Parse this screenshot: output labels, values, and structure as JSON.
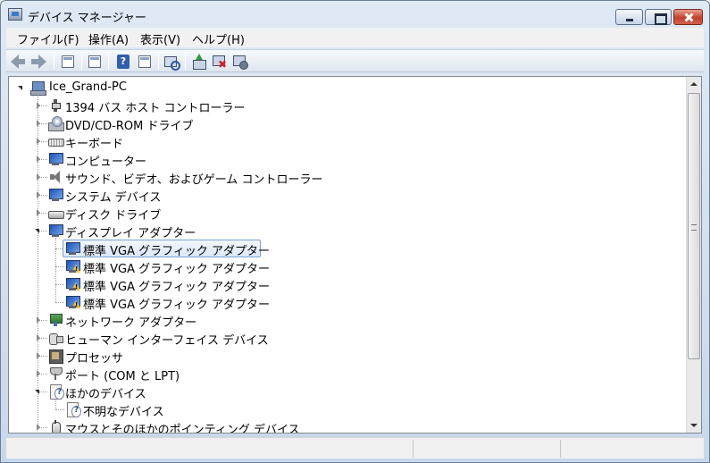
{
  "window": {
    "title": "デバイス マネージャー"
  },
  "menu": [
    "ファイル(F)",
    "操作(A)",
    "表示(V)",
    "ヘルプ(H)"
  ],
  "toolbar": [
    {
      "icon": "back-arrow-icon"
    },
    {
      "icon": "forward-arrow-icon"
    },
    {
      "icon": "show-hide-console-tree-icon"
    },
    {
      "icon": "properties-icon"
    },
    {
      "icon": "help-icon"
    },
    {
      "icon": "action-pane-icon"
    },
    {
      "icon": "scan-hardware-changes-icon"
    },
    {
      "icon": "update-driver-icon"
    },
    {
      "icon": "uninstall-icon"
    },
    {
      "icon": "disable-device-icon"
    }
  ],
  "tree": {
    "root": "Ice_Grand-PC",
    "items": [
      {
        "label": "1394 バス ホスト コントローラー",
        "icon": "usb",
        "level": 1,
        "state": "closed"
      },
      {
        "label": "DVD/CD-ROM ドライブ",
        "icon": "dvd",
        "level": 1,
        "state": "closed"
      },
      {
        "label": "キーボード",
        "icon": "kb",
        "level": 1,
        "state": "closed"
      },
      {
        "label": "コンピューター",
        "icon": "mon",
        "level": 1,
        "state": "closed"
      },
      {
        "label": "サウンド、ビデオ、およびゲーム コントローラー",
        "icon": "speaker",
        "level": 1,
        "state": "closed"
      },
      {
        "label": "システム デバイス",
        "icon": "mon",
        "level": 1,
        "state": "closed"
      },
      {
        "label": "ディスク ドライブ",
        "icon": "disk",
        "level": 1,
        "state": "closed"
      },
      {
        "label": "ディスプレイ アダプター",
        "icon": "mon",
        "level": 1,
        "state": "open"
      },
      {
        "label": "標準 VGA グラフィック アダプター",
        "icon": "mon",
        "level": 2,
        "selected": true
      },
      {
        "label": "標準 VGA グラフィック アダプター",
        "icon": "mon",
        "level": 2,
        "warning": true
      },
      {
        "label": "標準 VGA グラフィック アダプター",
        "icon": "mon",
        "level": 2,
        "warning": true
      },
      {
        "label": "標準 VGA グラフィック アダプター",
        "icon": "mon",
        "level": 2,
        "warning": true
      },
      {
        "label": "ネットワーク アダプター",
        "icon": "net",
        "level": 1,
        "state": "closed"
      },
      {
        "label": "ヒューマン インターフェイス デバイス",
        "icon": "hid",
        "level": 1,
        "state": "closed"
      },
      {
        "label": "プロセッサ",
        "icon": "cpu",
        "level": 1,
        "state": "closed"
      },
      {
        "label": "ポート (COM と LPT)",
        "icon": "port",
        "level": 1,
        "state": "closed"
      },
      {
        "label": "ほかのデバイス",
        "icon": "unk",
        "level": 1,
        "state": "open"
      },
      {
        "label": "不明なデバイス",
        "icon": "unk",
        "level": 2,
        "warning": true
      },
      {
        "label": "マウスとそのほかのポインティング デバイス",
        "icon": "mouse",
        "level": 1,
        "state": "closed"
      }
    ]
  }
}
